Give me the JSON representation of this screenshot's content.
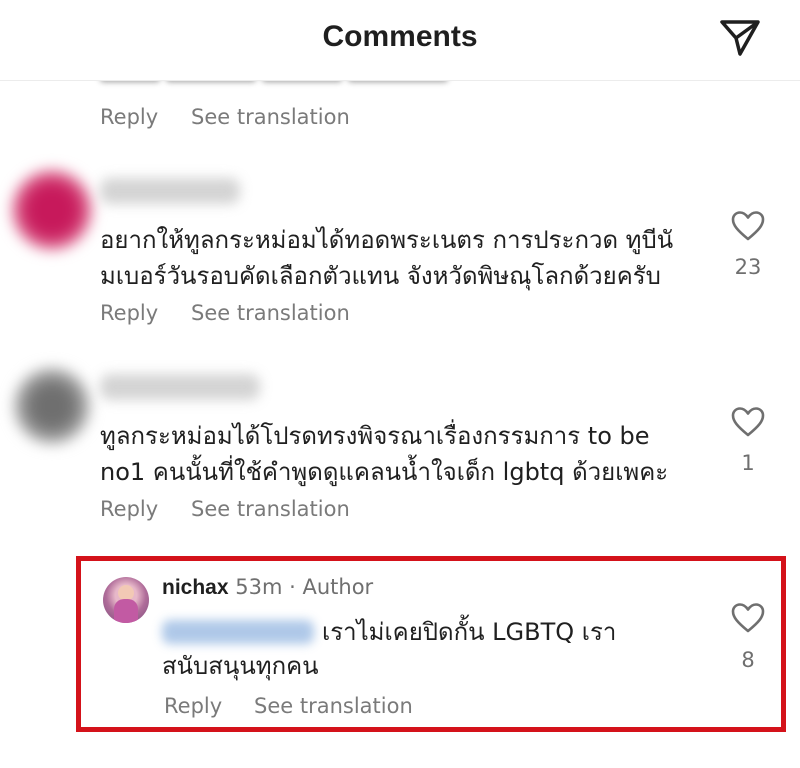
{
  "header": {
    "title": "Comments"
  },
  "action_labels": {
    "reply": "Reply",
    "see_translation": "See translation"
  },
  "comments": [
    {
      "text_lines": [
        "อยากให้ทูลกระหม่อมได้ทอดพระเนตร การประกวด ทูบีนั",
        "มเบอร์วันรอบคัดเลือกตัวแทน จังหวัดพิษณุโลกด้วยครับ"
      ],
      "likes": "23"
    },
    {
      "text_lines": [
        "ทูลกระหม่อมได้โปรดทรงพิจรณาเรื่องกรรมการ to be",
        "no1 คนนั้นที่ใช้คำพูดดูแคลนน้ำใจเด็ก lgbtq ด้วยเพคะ"
      ],
      "likes": "1"
    }
  ],
  "reply": {
    "username": "nichax",
    "time": "53m",
    "separator": "·",
    "badge": "Author",
    "text_lines": [
      "เราไม่เคยปิดกั้น LGBTQ เรา",
      "สนับสนุนทุกคน"
    ],
    "likes": "8"
  },
  "colors": {
    "highlight_border": "#d4121a",
    "secondary_text": "#7a7a7a"
  },
  "icons": {
    "send": "paper-plane-icon",
    "like": "heart-outline-icon"
  }
}
